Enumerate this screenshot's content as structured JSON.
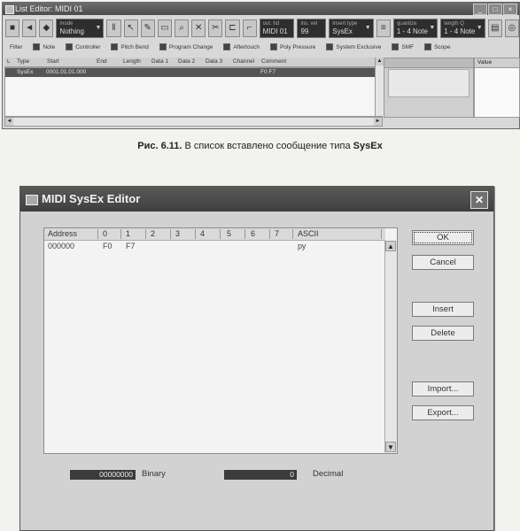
{
  "list_editor": {
    "title": "List Editor: MIDI 01",
    "window_buttons": [
      "_",
      "□",
      "×"
    ],
    "toolbar": {
      "mode_caption": "mode",
      "mode_value": "Nothing",
      "out_caption": "out. hd",
      "out_value": "MIDI 01",
      "ins_caption": "ins. vel",
      "ins_value": "99",
      "insert_type_caption": "Insert type",
      "insert_type_value": "SysEx",
      "quantize_caption": "quantize",
      "quantize_value": "1 - 4 Note",
      "length_caption": "length Q",
      "length_value": "1 - 4 Note"
    },
    "filters": [
      "Filter",
      "Note",
      "Controller",
      "Pitch Bend",
      "Program Change",
      "Aftertouch",
      "Poly Pressure",
      "System Exclusive",
      "SMF",
      "Scope"
    ],
    "columns": [
      "L",
      "Type",
      "Start",
      "End",
      "Length",
      "Data 1",
      "Data 2",
      "Data 3",
      "Channel",
      "Comment"
    ],
    "rows": [
      {
        "type": "SysEx",
        "start": "0001.01.01.000",
        "comment": "F0 F7"
      }
    ],
    "value_header": "Value"
  },
  "caption": {
    "prefix": "Рис. 6.11.",
    "text": " В список вставлено сообщение типа ",
    "bold": "SysEx"
  },
  "sysex_editor": {
    "title": "MIDI SysEx Editor",
    "columns": [
      "Address",
      "0",
      "1",
      "2",
      "3",
      "4",
      "5",
      "6",
      "7",
      "ASCII"
    ],
    "rows": [
      {
        "address": "000000",
        "b0": "F0",
        "b1": "F7",
        "ascii": "ру"
      }
    ],
    "buttons": {
      "ok": "OK",
      "cancel": "Cancel",
      "insert": "Insert",
      "delete": "Delete",
      "import": "Import...",
      "export": "Export..."
    },
    "binary_value": "00000000",
    "binary_label": "Binary",
    "decimal_value": "0",
    "decimal_label": "Decimal"
  },
  "colors": {
    "title_bar": "#4c4c4c",
    "selected_row": "#555555",
    "dialog_bg": "#d2d2d2",
    "field_dark": "#3b3b3b"
  }
}
